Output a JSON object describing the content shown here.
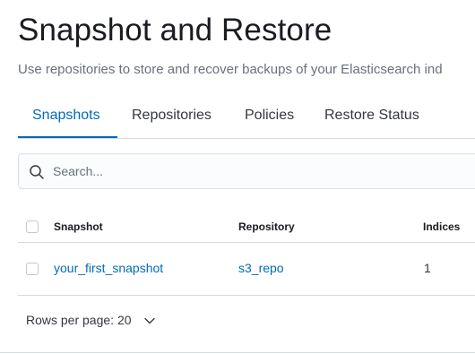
{
  "page": {
    "title": "Snapshot and Restore",
    "subtitle": "Use repositories to store and recover backups of your Elasticsearch ind"
  },
  "tabs": [
    {
      "label": "Snapshots",
      "active": true
    },
    {
      "label": "Repositories",
      "active": false
    },
    {
      "label": "Policies",
      "active": false
    },
    {
      "label": "Restore Status",
      "active": false
    }
  ],
  "search": {
    "placeholder": "Search...",
    "value": "",
    "icon": "search-icon"
  },
  "table": {
    "columns": [
      "Snapshot",
      "Repository",
      "Indices"
    ],
    "rows": [
      {
        "snapshot": "your_first_snapshot",
        "repository": "s3_repo",
        "indices": "1",
        "selected": false
      }
    ]
  },
  "pagination": {
    "rows_per_page_label": "Rows per page: 20",
    "icon": "chevron-down-icon"
  },
  "colors": {
    "accent": "#006bb8",
    "text": "#343741",
    "muted": "#69707d",
    "border": "#d3dae6"
  }
}
